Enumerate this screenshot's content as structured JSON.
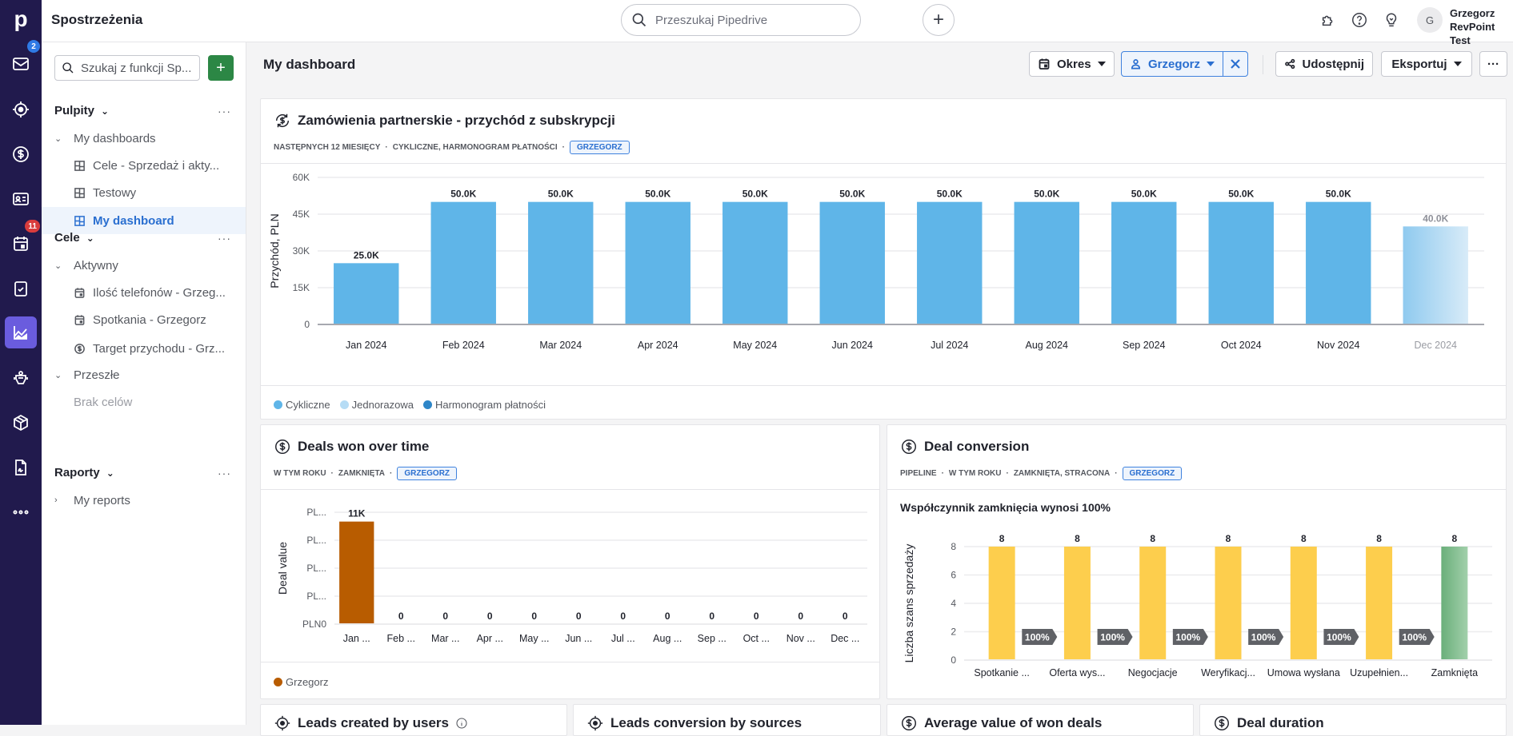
{
  "app": {
    "title": "Spostrzeżenia",
    "logo": "p"
  },
  "rail": {
    "items": [
      {
        "name": "mail-icon",
        "badge": "2",
        "badge_color": "#2f7ae5"
      },
      {
        "name": "leads-target-icon",
        "badge": null
      },
      {
        "name": "deals-dollar-icon",
        "badge": null
      },
      {
        "name": "contacts-card-icon",
        "badge": null
      },
      {
        "name": "calendar-icon",
        "badge": "11",
        "badge_color": "#d93c3c"
      },
      {
        "name": "tasks-clipboard-icon",
        "badge": null
      },
      {
        "name": "insights-chart-icon",
        "badge": null,
        "active": true
      },
      {
        "name": "ai-bot-icon",
        "badge": null
      },
      {
        "name": "products-box-icon",
        "badge": null
      },
      {
        "name": "documents-sign-icon",
        "badge": null
      },
      {
        "name": "more-dots-icon",
        "badge": null
      }
    ]
  },
  "topbar": {
    "search_placeholder": "Przeszukaj Pipedrive",
    "user": {
      "initial": "G",
      "name": "Grzegorz",
      "company": "RevPoint Test"
    }
  },
  "sidebar": {
    "search_placeholder": "Szukaj z funkcji Sp...",
    "sections": {
      "dashboards": {
        "label": "Pulpity",
        "group": "My dashboards",
        "items": [
          "Cele - Sprzedaż i akty...",
          "Testowy",
          "My dashboard"
        ],
        "selected": "My dashboard"
      },
      "goals": {
        "label": "Cele",
        "active_group": "Aktywny",
        "active_items": [
          "Ilość telefonów - Grzeg...",
          "Spotkania - Grzegorz",
          "Target przychodu - Grz..."
        ],
        "past_group": "Przeszłe",
        "past_empty": "Brak celów"
      },
      "reports": {
        "label": "Raporty",
        "group": "My reports"
      }
    }
  },
  "dashboard": {
    "title": "My dashboard",
    "period_label": "Okres",
    "user_filter": "Grzegorz",
    "share_label": "Udostępnij",
    "export_label": "Eksportuj"
  },
  "cards": {
    "revenue": {
      "title": "Zamówienia partnerskie - przychód z subskrypcji",
      "filters": [
        "NASTĘPNYCH 12 MIESIĘCY",
        "CYKLICZNE, HARMONOGRAM PŁATNOŚCI"
      ],
      "pill": "GRZEGORZ",
      "legend": [
        {
          "label": "Cykliczne",
          "color": "#5fb5e8"
        },
        {
          "label": "Jednorazowa",
          "color": "#b6dcf5"
        },
        {
          "label": "Harmonogram płatności",
          "color": "#2e86c8"
        }
      ]
    },
    "deals_won": {
      "title": "Deals won over time",
      "filters": [
        "W TYM ROKU",
        "ZAMKNIĘTA"
      ],
      "pill": "GRZEGORZ",
      "legend": [
        {
          "label": "Grzegorz",
          "color": "#b85c00"
        }
      ]
    },
    "conversion": {
      "title": "Deal conversion",
      "filters": [
        "PIPELINE",
        "W TYM ROKU",
        "ZAMKNIĘTA, STRACONA"
      ],
      "pill": "GRZEGORZ",
      "summary": "Współczynnik zamknięcia wynosi 100%"
    },
    "bottom": [
      {
        "title": "Leads created by users",
        "icon": "leads-target-icon",
        "info": true
      },
      {
        "title": "Leads conversion by sources",
        "icon": "leads-target-icon",
        "info": false
      },
      {
        "title": "Average value of won deals",
        "icon": "deals-dollar-icon",
        "info": false
      },
      {
        "title": "Deal duration",
        "icon": "deals-dollar-icon",
        "info": false
      }
    ]
  },
  "chart_data": [
    {
      "type": "bar",
      "title": "Zamówienia partnerskie - przychód z subskrypcji",
      "xlabel": "",
      "ylabel": "Przychód, PLN",
      "ylim": [
        0,
        60000
      ],
      "yticks": [
        "0",
        "15K",
        "30K",
        "45K",
        "60K"
      ],
      "grid": true,
      "legend": "bottom-left",
      "categories": [
        "Jan 2024",
        "Feb 2024",
        "Mar 2024",
        "Apr 2024",
        "May 2024",
        "Jun 2024",
        "Jul 2024",
        "Aug 2024",
        "Sep 2024",
        "Oct 2024",
        "Nov 2024",
        "Dec 2024"
      ],
      "series": [
        {
          "name": "Cykliczne",
          "values": [
            25000,
            50000,
            50000,
            50000,
            50000,
            50000,
            50000,
            50000,
            50000,
            50000,
            50000,
            40000
          ]
        }
      ],
      "labels": [
        "25.0K",
        "50.0K",
        "50.0K",
        "50.0K",
        "50.0K",
        "50.0K",
        "50.0K",
        "50.0K",
        "50.0K",
        "50.0K",
        "50.0K",
        "40.0K"
      ],
      "projected_index": 11
    },
    {
      "type": "bar",
      "title": "Deals won over time",
      "xlabel": "",
      "ylabel": "Deal value",
      "ylim": [
        0,
        12000
      ],
      "yticks": [
        "PLN0",
        "PL...",
        "PL...",
        "PL...",
        "PL..."
      ],
      "grid": true,
      "legend": "bottom-left",
      "categories": [
        "Jan ...",
        "Feb ...",
        "Mar ...",
        "Apr ...",
        "May ...",
        "Jun ...",
        "Jul ...",
        "Aug ...",
        "Sep ...",
        "Oct ...",
        "Nov ...",
        "Dec ..."
      ],
      "series": [
        {
          "name": "Grzegorz",
          "values": [
            11000,
            0,
            0,
            0,
            0,
            0,
            0,
            0,
            0,
            0,
            0,
            0
          ]
        }
      ],
      "labels": [
        "11K",
        "0",
        "0",
        "0",
        "0",
        "0",
        "0",
        "0",
        "0",
        "0",
        "0",
        "0"
      ]
    },
    {
      "type": "bar",
      "title": "Deal conversion",
      "xlabel": "",
      "ylabel": "Liczba szans sprzedaży",
      "ylim": [
        0,
        8
      ],
      "yticks": [
        "0",
        "2",
        "4",
        "6",
        "8"
      ],
      "grid": true,
      "categories": [
        "Spotkanie ...",
        "Oferta wys...",
        "Negocjacje",
        "Weryfikacj...",
        "Umowa wysłana",
        "Uzupełnien...",
        "Zamknięta"
      ],
      "series": [
        {
          "name": "Deals",
          "values": [
            8,
            8,
            8,
            8,
            8,
            8,
            8
          ]
        }
      ],
      "labels": [
        "8",
        "8",
        "8",
        "8",
        "8",
        "8",
        "8"
      ],
      "conversion_rates": [
        "100%",
        "100%",
        "100%",
        "100%",
        "100%",
        "100%"
      ]
    }
  ]
}
